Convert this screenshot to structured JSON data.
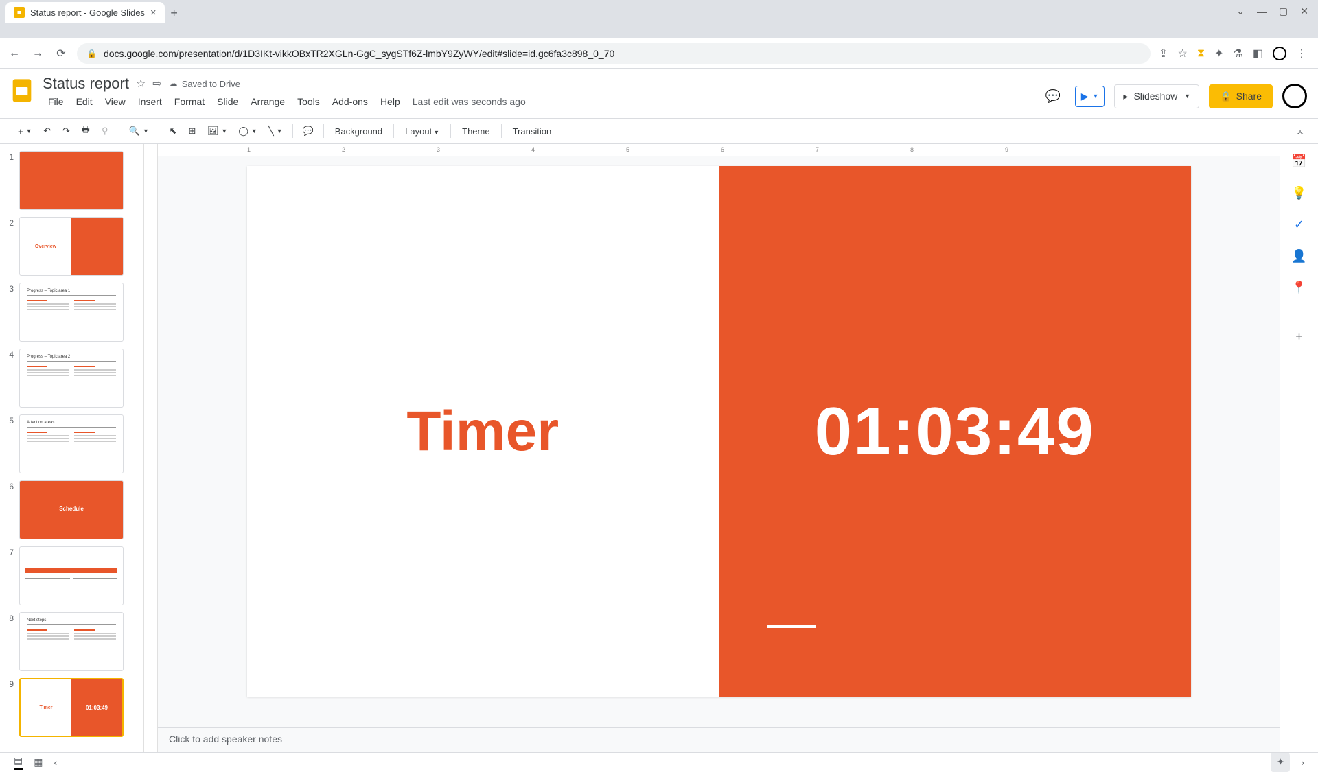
{
  "browser": {
    "tab_title": "Status report - Google Slides",
    "url": "docs.google.com/presentation/d/1D3IKt-vikkOBxTR2XGLn-GgC_sygSTf6Z-lmbY9ZyWY/edit#slide=id.gc6fa3c898_0_70"
  },
  "doc": {
    "title": "Status report",
    "saved_text": "Saved to Drive",
    "last_edit": "Last edit was seconds ago"
  },
  "menus": [
    "File",
    "Edit",
    "View",
    "Insert",
    "Format",
    "Slide",
    "Arrange",
    "Tools",
    "Add-ons",
    "Help"
  ],
  "toolbar": {
    "background": "Background",
    "layout": "Layout",
    "theme": "Theme",
    "transition": "Transition"
  },
  "header_buttons": {
    "slideshow": "Slideshow",
    "share": "Share"
  },
  "slide": {
    "title": "Timer",
    "timer_value": "01:03:49"
  },
  "speaker_notes_placeholder": "Click to add speaker notes",
  "thumbs": [
    {
      "num": "1",
      "type": "orange-full",
      "text": ""
    },
    {
      "num": "2",
      "type": "half",
      "left": "Overview",
      "right": ""
    },
    {
      "num": "3",
      "type": "text",
      "title": "Progress – Topic area 1"
    },
    {
      "num": "4",
      "type": "text",
      "title": "Progress – Topic area 2"
    },
    {
      "num": "5",
      "type": "text",
      "title": "Attention areas"
    },
    {
      "num": "6",
      "type": "orange-full",
      "text": "Schedule"
    },
    {
      "num": "7",
      "type": "timeline",
      "title": ""
    },
    {
      "num": "8",
      "type": "text",
      "title": "Next steps"
    },
    {
      "num": "9",
      "type": "half",
      "left": "Timer",
      "right": "01:03:49",
      "selected": true
    }
  ],
  "ruler_marks": [
    "1",
    "2",
    "3",
    "4",
    "5",
    "6",
    "7",
    "8",
    "9"
  ],
  "colors": {
    "accent": "#e8562a",
    "share": "#fbbc04"
  }
}
